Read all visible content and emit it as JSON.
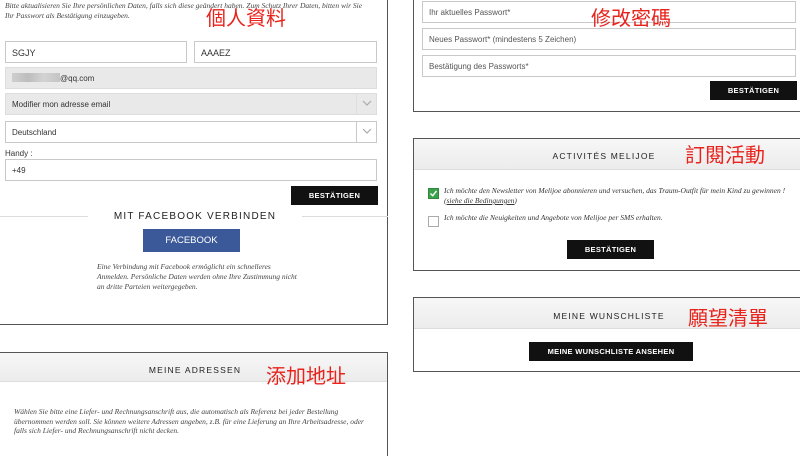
{
  "labels": {
    "personal": "個人資料",
    "password": "修改密碼",
    "subscribe": "訂閱活動",
    "wishlist": "願望清單",
    "address": "添加地址"
  },
  "personal": {
    "intro": "Bitte aktualisieren Sie Ihre persönlichen Daten, falls sich diese geändert haben. Zum Schutz Ihrer Daten, bitten wir Sie Ihr Passwort als Bestätigung einzugeben.",
    "first_name": "SGJY",
    "last_name": "AAAEZ",
    "email_suffix": "@qq.com",
    "email_select": "Modifier mon adresse email",
    "country": "Deutschland",
    "phone_label": "Handy :",
    "phone_value": "+49",
    "confirm_button": "BESTÄTIGEN",
    "facebook_title": "MIT FACEBOOK VERBINDEN",
    "facebook_button": "FACEBOOK",
    "facebook_note": "Eine Verbindung mit Facebook ermöglicht ein schnelleres Anmelden. Persönliche Daten werden ohne Ihre Zustimmung nicht an dritte Parteien weitergegeben."
  },
  "password": {
    "current_placeholder": "Ihr aktuelles Passwort*",
    "new_placeholder": "Neues Passwort* (mindestens 5 Zeichen)",
    "confirm_placeholder": "Bestätigung des Passworts*",
    "confirm_button": "BESTÄTIGEN"
  },
  "activities": {
    "title": "ACTIVITÉS MELIJOE",
    "newsletter_text": "Ich möchte den Newsletter von Melijoe abonnieren und versuchen, das Traum-Outfit für mein Kind zu gewinnen ! (",
    "newsletter_link": "siehe die Bedingungen",
    "newsletter_close": ")",
    "newsletter_checked": true,
    "sms_text": "Ich möchte die Neuigkeiten und Angebote von Melijoe per SMS erhalten.",
    "sms_checked": false,
    "confirm_button": "BESTÄTIGEN"
  },
  "wishlist": {
    "title": "MEINE WUNSCHLISTE",
    "button": "MEINE WUNSCHLISTE ANSEHEN"
  },
  "addresses": {
    "title": "MEINE ADRESSEN",
    "text": "Wählen Sie bitte eine Liefer- und Rechnungsanschrift aus, die automatisch als Referenz bei jeder Bestellung übernommen werden soll. Sie können weitere Adressen angeben, z.B. für eine Lieferung an Ihre Arbeitsadresse, oder falls sich Liefer- und Rechnungsanschrift nicht decken."
  },
  "colors": {
    "accent_red": "#e8231c",
    "facebook_blue": "#3b5998",
    "check_green": "#3aa34a",
    "button_black": "#111111"
  }
}
